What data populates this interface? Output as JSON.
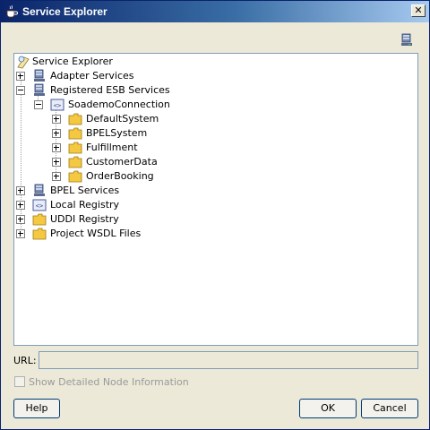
{
  "window": {
    "title": "Service Explorer"
  },
  "toolbar": {
    "icon": "server-network-icon"
  },
  "tree": {
    "root": {
      "label": "Service Explorer",
      "icon": "explorer-icon"
    },
    "nodes": [
      {
        "label": "Adapter Services",
        "icon": "server-icon",
        "expanded": false
      },
      {
        "label": "Registered ESB Services",
        "icon": "server-icon",
        "expanded": true,
        "children": [
          {
            "label": "SoademoConnection",
            "icon": "connection-icon",
            "expanded": true,
            "children": [
              {
                "label": "DefaultSystem",
                "icon": "folder-icon"
              },
              {
                "label": "BPELSystem",
                "icon": "folder-icon"
              },
              {
                "label": "Fulfillment",
                "icon": "folder-icon"
              },
              {
                "label": "CustomerData",
                "icon": "folder-icon"
              },
              {
                "label": "OrderBooking",
                "icon": "folder-icon"
              }
            ]
          }
        ]
      },
      {
        "label": "BPEL Services",
        "icon": "server-icon",
        "expanded": false
      },
      {
        "label": "Local Registry",
        "icon": "connection-icon",
        "expanded": false
      },
      {
        "label": "UDDI Registry",
        "icon": "folder-icon",
        "expanded": false
      },
      {
        "label": "Project WSDL Files",
        "icon": "folder-icon",
        "expanded": false
      }
    ]
  },
  "url": {
    "label": "URL:",
    "value": ""
  },
  "details_checkbox": {
    "label": "Show Detailed Node Information",
    "checked": false,
    "enabled": false
  },
  "buttons": {
    "help": {
      "label": "Help",
      "mnemonic": "H"
    },
    "ok": {
      "label": "OK",
      "mnemonic": "O"
    },
    "cancel": {
      "label": "Cancel",
      "mnemonic": "C"
    }
  },
  "colors": {
    "titlebar_start": "#0a246a",
    "titlebar_end": "#a6caf0",
    "dialog_bg": "#ece9d8",
    "folder": "#f5c842"
  }
}
